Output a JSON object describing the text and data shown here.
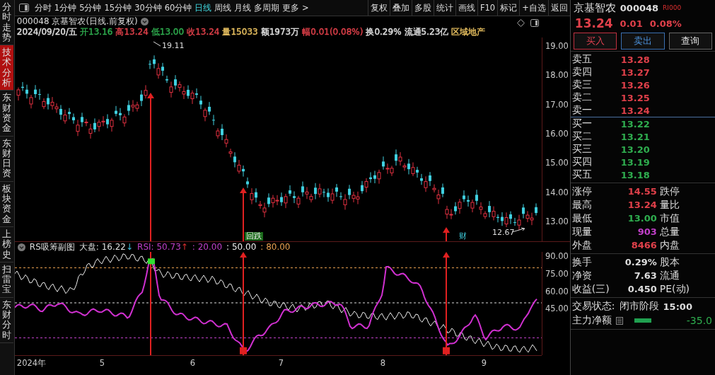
{
  "side_tabs": [
    {
      "label": "分时走势",
      "selected": false
    },
    {
      "label": "技术分析",
      "selected": true
    },
    {
      "label": "东财资金",
      "selected": false
    },
    {
      "label": "东财日资",
      "selected": false
    },
    {
      "label": "板块资金",
      "selected": false
    },
    {
      "label": "上榜史",
      "selected": false
    },
    {
      "label": "扫雷宝",
      "selected": false
    },
    {
      "label": "东财分时",
      "selected": false
    }
  ],
  "periods": [
    {
      "label": "分时",
      "selected": false
    },
    {
      "label": "1分钟",
      "selected": false
    },
    {
      "label": "5分钟",
      "selected": false
    },
    {
      "label": "15分钟",
      "selected": false
    },
    {
      "label": "30分钟",
      "selected": false
    },
    {
      "label": "60分钟",
      "selected": false
    },
    {
      "label": "日线",
      "selected": true
    },
    {
      "label": "周线",
      "selected": false
    },
    {
      "label": "月线",
      "selected": false
    },
    {
      "label": "多周期",
      "selected": false
    },
    {
      "label": "更多 >",
      "selected": false
    }
  ],
  "tools": [
    "复权",
    "叠加",
    "多股",
    "统计",
    "画线",
    "F10",
    "标记",
    "+自选",
    "返回"
  ],
  "chart_title": "000048 京基智农(日线.前复权)",
  "quote": [
    {
      "text": "2024/09/20/五",
      "color": "#e0e0e0"
    },
    {
      "text": "开13.16",
      "color": "#2fae4f"
    },
    {
      "text": "高13.24",
      "color": "#e0404a"
    },
    {
      "text": "低13.00",
      "color": "#2fae4f"
    },
    {
      "text": "收13.24",
      "color": "#e0404a"
    },
    {
      "text": "量15033",
      "color": "#e8c060"
    },
    {
      "text": "额1973万",
      "color": "#e0e0e0"
    },
    {
      "text": "幅0.01(0.08%)",
      "color": "#e0404a"
    },
    {
      "text": "换0.29%",
      "color": "#e0e0e0"
    },
    {
      "text": "流通5.23亿",
      "color": "#e0e0e0"
    },
    {
      "text": "区域地产",
      "color": "#e8c060"
    }
  ],
  "price_axis": [
    "19.00",
    "18.00",
    "17.00",
    "16.00",
    "15.00",
    "14.00",
    "13.00"
  ],
  "annotations": {
    "high": "19.11",
    "low": "12.67",
    "event_1": "回跌",
    "event_2": "财"
  },
  "indicator": {
    "name": "RS吸筹副图",
    "market": "大盘: 16.22",
    "market_arrow": "↓",
    "rsi": "RSI: 50.73",
    "rsi_arrow": "↑",
    "low_line": ": 20.00",
    "mid_line": ": 50.00",
    "high_line": ": 80.00"
  },
  "indicator_axis": [
    "90.00",
    "75.00",
    "60.00",
    "45.00"
  ],
  "time_axis": [
    "2024年",
    "5",
    "6",
    "7",
    "8",
    "9"
  ],
  "stock": {
    "name": "京基智农",
    "code": "000048",
    "tag": "RI000",
    "price": "13.24",
    "change": "0.01",
    "percent": "0.08%"
  },
  "trade_buttons": [
    {
      "label": "买入",
      "kind": "buy"
    },
    {
      "label": "卖出",
      "kind": "sell"
    },
    {
      "label": "查询",
      "kind": "query"
    }
  ],
  "order_book": [
    {
      "label": "卖五",
      "price": "13.28",
      "kind": "ask"
    },
    {
      "label": "卖四",
      "price": "13.27",
      "kind": "ask"
    },
    {
      "label": "卖三",
      "price": "13.26",
      "kind": "ask"
    },
    {
      "label": "卖二",
      "price": "13.25",
      "kind": "ask"
    },
    {
      "label": "卖一",
      "price": "13.24",
      "kind": "ask"
    },
    {
      "label": "买一",
      "price": "13.22",
      "kind": "bid"
    },
    {
      "label": "买二",
      "price": "13.21",
      "kind": "bid"
    },
    {
      "label": "买三",
      "price": "13.20",
      "kind": "bid"
    },
    {
      "label": "买四",
      "price": "13.19",
      "kind": "bid"
    },
    {
      "label": "买五",
      "price": "13.18",
      "kind": "bid"
    }
  ],
  "stats": [
    {
      "label": "涨停",
      "value": "14.55",
      "color": "#e0404a",
      "label2": "跌停"
    },
    {
      "label": "最高",
      "value": "13.24",
      "color": "#e0404a",
      "label2": "量比"
    },
    {
      "label": "最低",
      "value": "13.00",
      "color": "#2fae4f",
      "label2": "市值"
    },
    {
      "label": "现量",
      "value": "903",
      "color": "#c040c8",
      "label2": "总量"
    },
    {
      "label": "外盘",
      "value": "8466",
      "color": "#e0404a",
      "label2": "内盘"
    }
  ],
  "finance": [
    {
      "label": "换手",
      "value": "0.29%",
      "label2": "股本"
    },
    {
      "label": "净资",
      "value": "7.63",
      "label2": "流通"
    },
    {
      "label": "收益(三)",
      "value": "0.450",
      "label2": "PE(动)"
    }
  ],
  "status": {
    "label": "交易状态:",
    "value": "闭市阶段",
    "time": "15:00"
  },
  "main_force": {
    "label": "主力净额",
    "value": "-35.0"
  }
}
